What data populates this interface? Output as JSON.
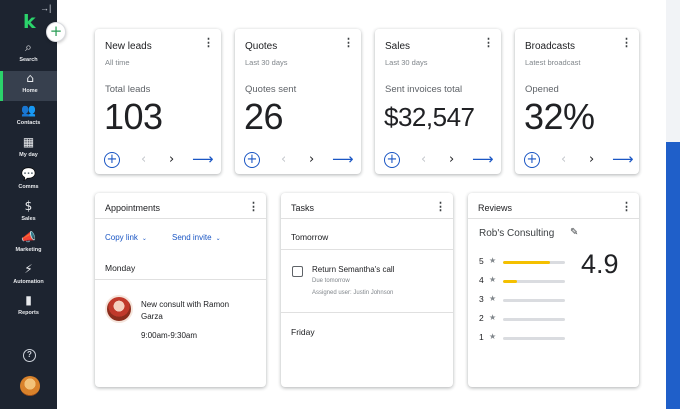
{
  "sidebar": {
    "logo": "k",
    "collapse_icon": "collapse-icon",
    "items": [
      {
        "label": "Search",
        "icon": "⌕"
      },
      {
        "label": "Home",
        "icon": "⌂"
      },
      {
        "label": "Contacts",
        "icon": "👥"
      },
      {
        "label": "My day",
        "icon": "▦"
      },
      {
        "label": "Comms",
        "icon": "💬"
      },
      {
        "label": "Sales",
        "icon": "$"
      },
      {
        "label": "Marketing",
        "icon": "📣"
      },
      {
        "label": "Automation",
        "icon": "⚡"
      },
      {
        "label": "Reports",
        "icon": "▮"
      }
    ],
    "active_item": "Home",
    "help_icon": "?"
  },
  "add_button": "+",
  "kpis": [
    {
      "title": "New leads",
      "subtitle": "All time",
      "label": "Total leads",
      "value": "103"
    },
    {
      "title": "Quotes",
      "subtitle": "Last 30 days",
      "label": "Quotes sent",
      "value": "26"
    },
    {
      "title": "Sales",
      "subtitle": "Last 30 days",
      "label": "Sent invoices total",
      "value": "$32,547"
    },
    {
      "title": "Broadcasts",
      "subtitle": "Latest broadcast",
      "label": "Opened",
      "value": "32%"
    }
  ],
  "kpi_controls": {
    "add": "+",
    "prev": "‹",
    "next": "›",
    "go": "⟶"
  },
  "appointments": {
    "title": "Appointments",
    "copy_link": "Copy link",
    "send_invite": "Send invite",
    "day": "Monday",
    "event_title_line1": "New consult with Ramon",
    "event_title_line2": "Garza",
    "event_time": "9:00am-9:30am"
  },
  "tasks": {
    "title": "Tasks",
    "group1": "Tomorrow",
    "task_title": "Return Semantha's call",
    "task_due": "Due tomorrow",
    "task_assigned": "Assigned user: Justin Johnson",
    "group2": "Friday"
  },
  "reviews": {
    "title": "Reviews",
    "business": "Rob's Consulting",
    "average": "4.9",
    "ratings": [
      {
        "stars": "5",
        "fraction": 0.75
      },
      {
        "stars": "4",
        "fraction": 0.22
      },
      {
        "stars": "3",
        "fraction": 0
      },
      {
        "stars": "2",
        "fraction": 0
      },
      {
        "stars": "1",
        "fraction": 0
      }
    ]
  },
  "colors": {
    "sidebar": "#1d2430",
    "accent_green": "#2bd36b",
    "link_blue": "#1a56c4",
    "star_yellow": "#f4c000",
    "edge_blue": "#1f5fc9"
  }
}
